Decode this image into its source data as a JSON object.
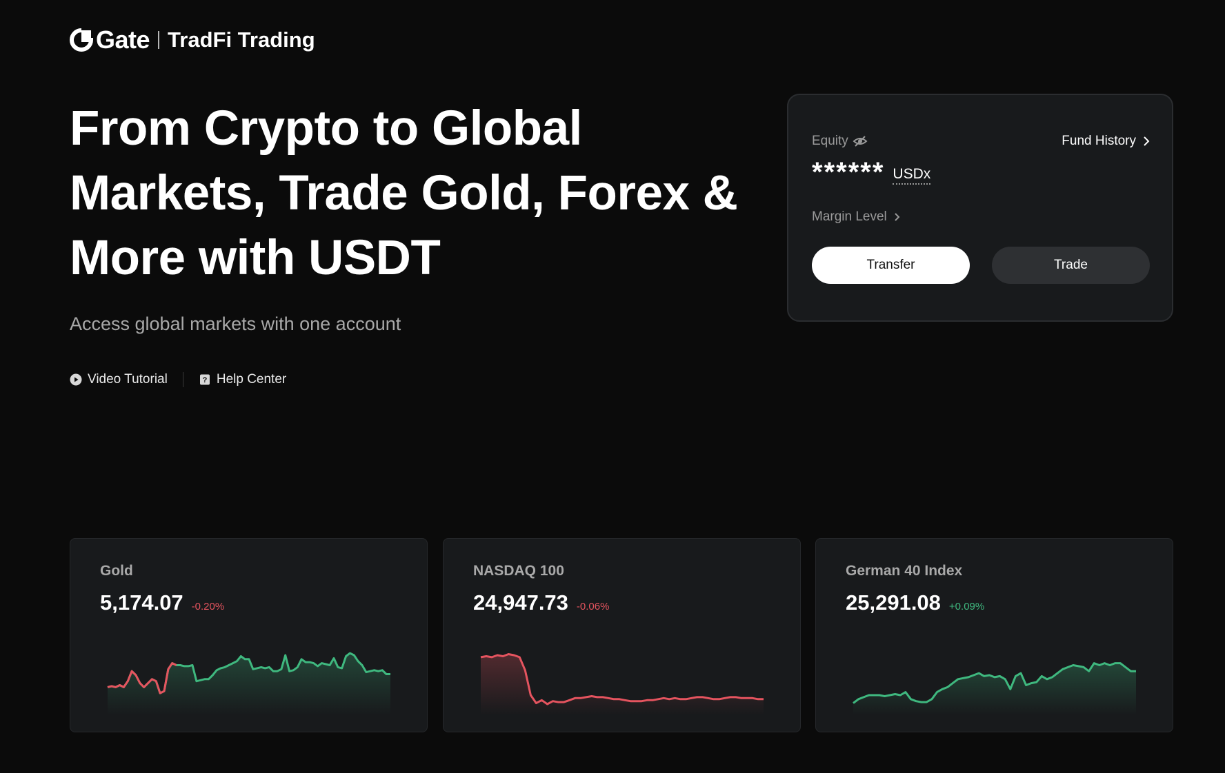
{
  "brand": {
    "name": "Gate",
    "product": "TradFi Trading"
  },
  "hero": {
    "title": "From Crypto to Global Markets, Trade Gold, Forex & More with USDT",
    "subtitle": "Access global markets with one account"
  },
  "links": {
    "video_tutorial": "Video Tutorial",
    "help_center": "Help Center"
  },
  "account": {
    "equity_label": "Equity",
    "equity_value": "******",
    "equity_unit": "USDx",
    "fund_history": "Fund History",
    "margin_level": "Margin Level",
    "transfer_label": "Transfer",
    "trade_label": "Trade"
  },
  "markets": [
    {
      "name": "Gold",
      "price": "5,174.07",
      "change": "-0.20%",
      "direction": "down",
      "color": "#3fb87f",
      "spark": [
        52,
        51,
        52,
        50,
        52,
        46,
        36,
        40,
        48,
        52,
        48,
        44,
        46,
        58,
        56,
        34,
        28,
        30,
        30,
        31,
        31,
        30,
        46,
        45,
        44,
        44,
        40,
        35,
        33,
        32,
        30,
        28,
        26,
        21,
        24,
        24,
        34,
        33,
        32,
        33,
        32,
        36,
        36,
        34,
        20,
        36,
        35,
        32,
        24,
        27,
        27,
        28,
        31,
        28,
        29,
        30,
        23,
        32,
        33,
        21,
        18,
        20,
        26,
        30,
        37,
        36,
        35,
        36,
        35,
        39,
        39
      ],
      "spark_red_segments": [
        [
          0,
          17
        ]
      ]
    },
    {
      "name": "NASDAQ 100",
      "price": "24,947.73",
      "change": "-0.06%",
      "direction": "down",
      "color": "#e5545f",
      "spark": [
        22,
        21,
        22,
        20,
        21,
        19,
        20,
        22,
        35,
        60,
        68,
        65,
        69,
        66,
        67,
        67,
        65,
        63,
        63,
        62,
        61,
        62,
        62,
        63,
        64,
        64,
        65,
        66,
        66,
        66,
        65,
        65,
        64,
        63,
        64,
        63,
        64,
        64,
        63,
        62,
        62,
        63,
        64,
        64,
        63,
        62,
        62,
        63,
        63,
        63,
        64,
        64
      ],
      "spark_red_segments": []
    },
    {
      "name": "German 40 Index",
      "price": "25,291.08",
      "change": "+0.09%",
      "direction": "up",
      "color": "#3fb87f",
      "spark": [
        68,
        64,
        62,
        60,
        60,
        60,
        61,
        60,
        59,
        60,
        57,
        64,
        66,
        67,
        67,
        64,
        57,
        54,
        52,
        48,
        44,
        43,
        42,
        40,
        38,
        41,
        40,
        42,
        41,
        44,
        54,
        41,
        38,
        50,
        48,
        47,
        41,
        44,
        42,
        38,
        34,
        32,
        30,
        31,
        32,
        36,
        28,
        30,
        28,
        30,
        28,
        28,
        32,
        36,
        36
      ]
    }
  ]
}
